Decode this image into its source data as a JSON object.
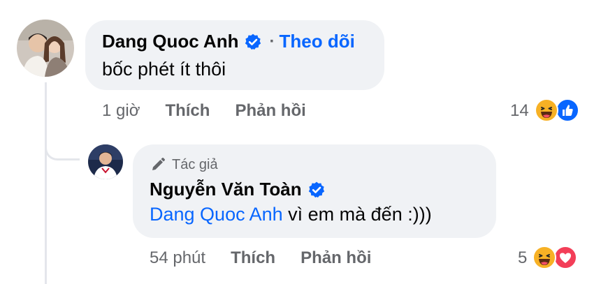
{
  "comment": {
    "author": "Dang Quoc Anh",
    "separator": "·",
    "follow_label": "Theo dõi",
    "text": "bốc phét ít thôi",
    "time": "1 giờ",
    "like_label": "Thích",
    "reply_label": "Phản hồi",
    "reaction_count": "14",
    "reaction_icons": [
      "haha-icon",
      "like-icon"
    ]
  },
  "reply": {
    "author_tag": "Tác giả",
    "author": "Nguyễn Văn Toàn",
    "mention": "Dang Quoc Anh",
    "text": " vì em mà đến :)))",
    "time": "54 phút",
    "like_label": "Thích",
    "reply_label": "Phản hồi",
    "reaction_count": "5",
    "reaction_icons": [
      "haha-icon",
      "love-icon"
    ]
  },
  "colors": {
    "link_blue": "#0866ff",
    "meta_gray": "#65676b",
    "bubble_bg": "#f0f2f5",
    "haha_yellow": "#f7b125",
    "love_red": "#f33e58"
  }
}
